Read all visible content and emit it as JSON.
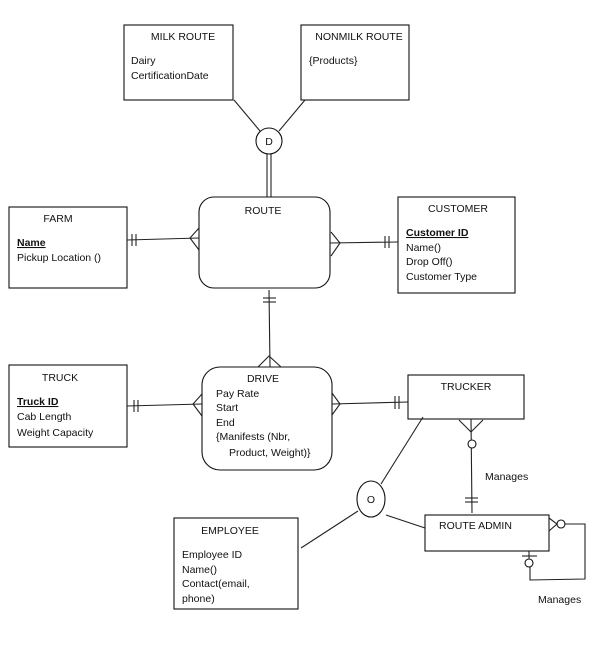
{
  "entities": {
    "milk_route": {
      "title": "MILK ROUTE",
      "attrs": [
        "Dairy",
        "CertificationDate"
      ]
    },
    "nonmilk_route": {
      "title": "NONMILK ROUTE",
      "attrs": [
        "{Products}"
      ]
    },
    "route": {
      "title": "ROUTE"
    },
    "farm": {
      "title": "FARM",
      "key": "Name",
      "attrs": [
        "Pickup Location ()"
      ]
    },
    "customer": {
      "title": "CUSTOMER",
      "key": "Customer ID",
      "attrs": [
        "Name()",
        "Drop Off()",
        "Customer Type"
      ]
    },
    "truck": {
      "title": "TRUCK",
      "key": "Truck ID",
      "attrs": [
        "Cab Length",
        "Weight Capacity"
      ]
    },
    "drive": {
      "title": "DRIVE",
      "attrs": [
        "Pay Rate",
        "Start",
        "End",
        "{Manifests (Nbr,",
        "Product, Weight)}"
      ]
    },
    "trucker": {
      "title": "TRUCKER"
    },
    "route_admin": {
      "title": "ROUTE ADMIN"
    },
    "employee": {
      "title": "EMPLOYEE",
      "attrs": [
        "Employee ID",
        "Name()",
        "Contact(email,",
        "phone)"
      ]
    }
  },
  "subtypes": {
    "disjoint_label": "D",
    "overlap_label": "O"
  },
  "relationships": {
    "trucker_admin_label": "Manages",
    "admin_self_label": "Manages"
  }
}
